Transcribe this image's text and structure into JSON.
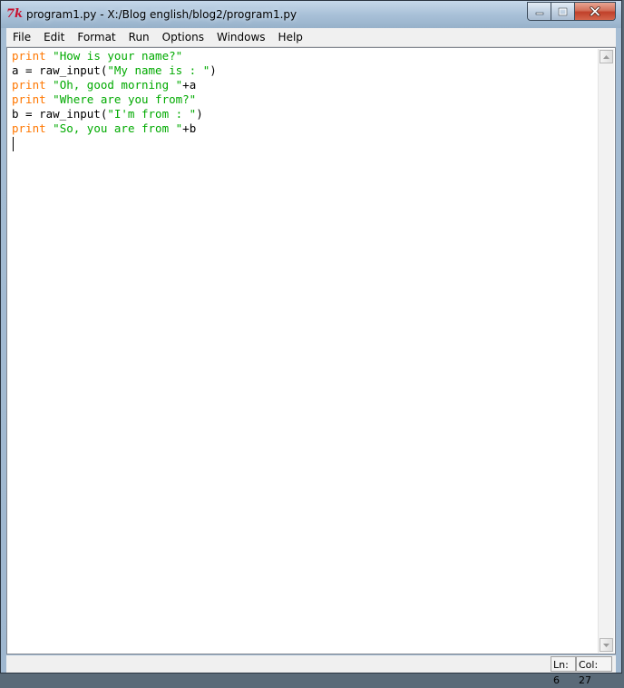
{
  "window": {
    "title": "program1.py - X:/Blog english/blog2/program1.py",
    "app_icon": "7k",
    "app_icon_name": "tk-feather-icon"
  },
  "caption_buttons": {
    "minimize": "minimize-icon",
    "maximize": "maximize-icon",
    "close": "close-icon"
  },
  "menu": {
    "items": [
      "File",
      "Edit",
      "Format",
      "Run",
      "Options",
      "Windows",
      "Help"
    ]
  },
  "editor": {
    "lines": [
      [
        {
          "t": "print",
          "c": "kw"
        },
        {
          "t": " "
        },
        {
          "t": "\"How is your name?\"",
          "c": "str"
        }
      ],
      [
        {
          "t": "a = raw_input("
        },
        {
          "t": "\"My name is : \"",
          "c": "str"
        },
        {
          "t": ")"
        }
      ],
      [
        {
          "t": "print",
          "c": "kw"
        },
        {
          "t": " "
        },
        {
          "t": "\"Oh, good morning \"",
          "c": "str"
        },
        {
          "t": "+a"
        }
      ],
      [
        {
          "t": "print",
          "c": "kw"
        },
        {
          "t": " "
        },
        {
          "t": "\"Where are you from?\"",
          "c": "str"
        }
      ],
      [
        {
          "t": "b = raw_input("
        },
        {
          "t": "\"I'm from : \"",
          "c": "str"
        },
        {
          "t": ")"
        }
      ],
      [
        {
          "t": "print",
          "c": "kw"
        },
        {
          "t": " "
        },
        {
          "t": "\"So, you are from \"",
          "c": "str"
        },
        {
          "t": "+b"
        }
      ]
    ],
    "colors": {
      "keyword": "#ff7700",
      "string": "#00aa00",
      "default": "#000000"
    }
  },
  "status": {
    "line": "Ln: 6",
    "col": "Col: 27"
  }
}
